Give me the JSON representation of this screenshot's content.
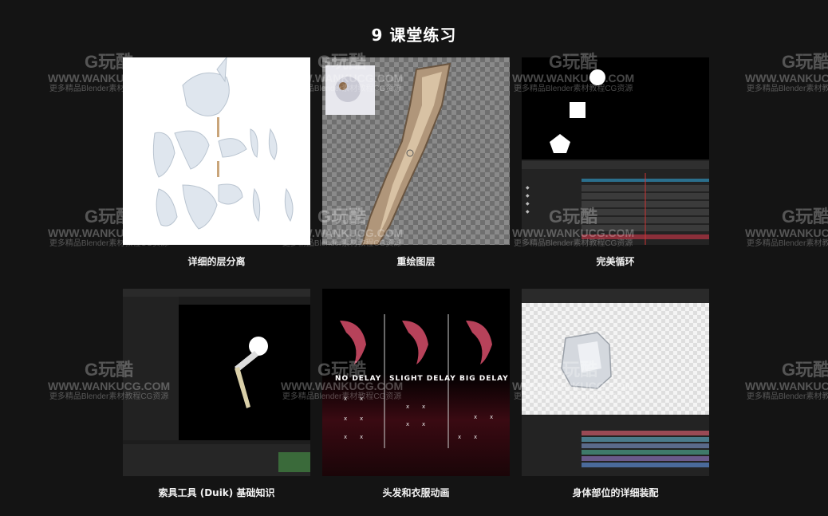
{
  "page": {
    "title": "9 课堂练习"
  },
  "cards": [
    {
      "caption": "详细的层分离"
    },
    {
      "caption": "重绘图层"
    },
    {
      "caption": "完美循环"
    },
    {
      "caption": "索具工具 (Duik) 基础知识"
    },
    {
      "caption": "头发和衣服动画"
    },
    {
      "caption": "身体部位的详细装配"
    }
  ],
  "delay_labels": {
    "no": "NO DELAY",
    "slight": "SLIGHT DELAY",
    "big": "BIG DELAY"
  },
  "watermark": {
    "logo": "G玩酷",
    "url": "WWW.WANKUCG.COM",
    "sub": "更多精品Blender素材教程CG资源"
  },
  "colors": {
    "background": "#141414",
    "text": "#ffffff"
  }
}
